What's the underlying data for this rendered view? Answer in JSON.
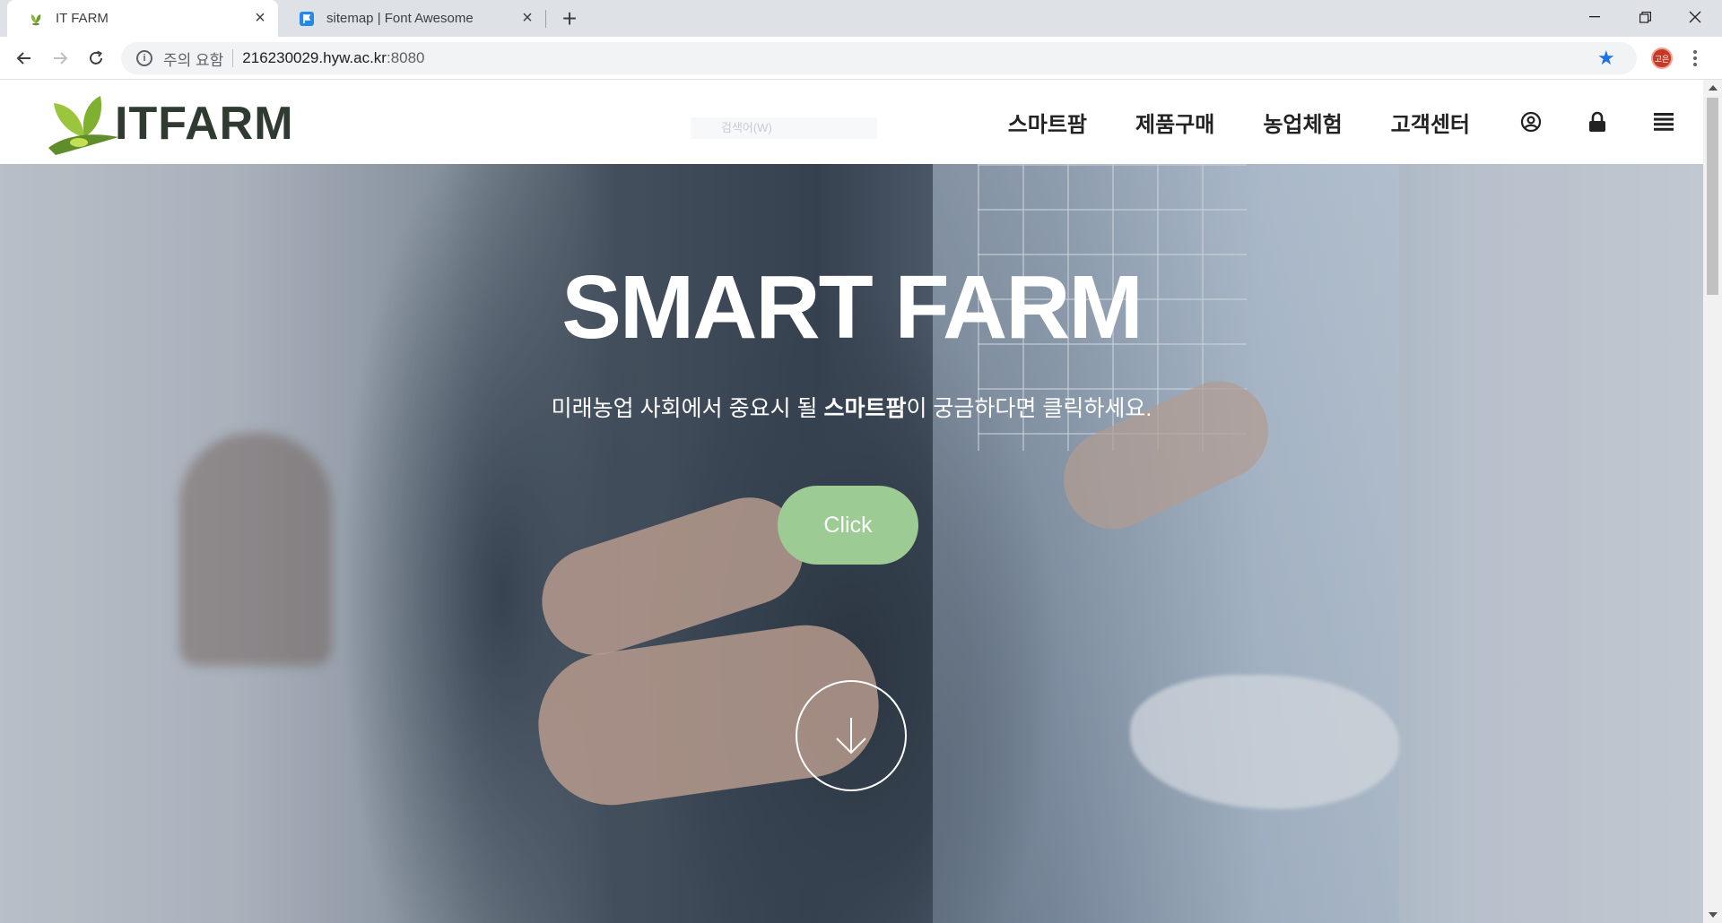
{
  "browser": {
    "tabs": [
      {
        "title": "IT FARM",
        "active": true,
        "favicon": "leaf-icon"
      },
      {
        "title": "sitemap | Font Awesome",
        "active": false,
        "favicon": "flag-icon"
      }
    ],
    "omnibox": {
      "security_warning": "주의 요함",
      "host": "216230029.hyw.ac.kr",
      "port": ":8080"
    },
    "profile_initials": "고은",
    "accent_color": "#1a73e8"
  },
  "site": {
    "logo_text": "ITFARM",
    "search_placeholder": "검색어(W)",
    "nav": {
      "items": [
        "스마트팜",
        "제품구매",
        "농업체험",
        "고객센터"
      ],
      "icons": [
        "user-circle-icon",
        "lock-icon",
        "menu-icon"
      ]
    }
  },
  "hero": {
    "title": "SMART FARM",
    "subtitle_before": "미래농업 사회에서 중요시 될 ",
    "subtitle_bold": "스마트팜",
    "subtitle_after": "이 궁금하다면 클릭하세요.",
    "button_label": "Click",
    "button_color": "#9ccb94",
    "scroll_icon": "arrow-down-icon"
  }
}
